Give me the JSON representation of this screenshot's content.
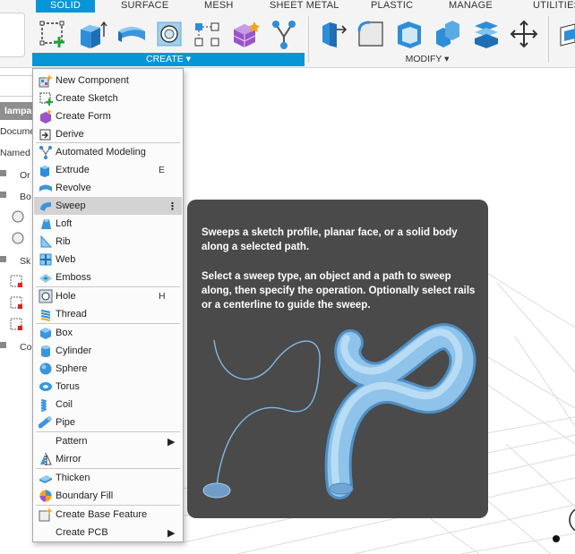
{
  "toolbar": {
    "tabs": [
      "SOLID",
      "SURFACE",
      "MESH",
      "SHEET METAL",
      "PLASTIC",
      "MANAGE",
      "UTILITIES"
    ],
    "create_label": "CREATE ▾",
    "modify_label": "MODIFY ▾",
    "accent": "#0696d7"
  },
  "browser": {
    "rows": [
      "lampa",
      "Docume",
      "Named V",
      "Or",
      "Bo",
      "Sk",
      "Co"
    ]
  },
  "menu": {
    "items": [
      {
        "label": "New Component",
        "icon": "new-component-icon"
      },
      {
        "label": "Create Sketch",
        "icon": "create-sketch-icon"
      },
      {
        "label": "Create Form",
        "icon": "create-form-icon"
      },
      {
        "label": "Derive",
        "icon": "derive-icon"
      },
      {
        "label": "Automated Modeling",
        "icon": "automated-modeling-icon"
      },
      {
        "label": "Extrude",
        "icon": "extrude-icon",
        "shortcut": "E"
      },
      {
        "label": "Revolve",
        "icon": "revolve-icon"
      },
      {
        "label": "Sweep",
        "icon": "sweep-icon"
      },
      {
        "label": "Loft",
        "icon": "loft-icon"
      },
      {
        "label": "Rib",
        "icon": "rib-icon"
      },
      {
        "label": "Web",
        "icon": "web-icon"
      },
      {
        "label": "Emboss",
        "icon": "emboss-icon"
      },
      {
        "label": "Hole",
        "icon": "hole-icon",
        "shortcut": "H"
      },
      {
        "label": "Thread",
        "icon": "thread-icon"
      },
      {
        "label": "Box",
        "icon": "box-icon"
      },
      {
        "label": "Cylinder",
        "icon": "cylinder-icon"
      },
      {
        "label": "Sphere",
        "icon": "sphere-icon"
      },
      {
        "label": "Torus",
        "icon": "torus-icon"
      },
      {
        "label": "Coil",
        "icon": "coil-icon"
      },
      {
        "label": "Pipe",
        "icon": "pipe-icon"
      },
      {
        "label": "Pattern",
        "icon": "pattern-icon"
      },
      {
        "label": "Mirror",
        "icon": "mirror-icon"
      },
      {
        "label": "Thicken",
        "icon": "thicken-icon"
      },
      {
        "label": "Boundary Fill",
        "icon": "boundary-fill-icon"
      },
      {
        "label": "Create Base Feature",
        "icon": "base-feature-icon"
      },
      {
        "label": "Create PCB",
        "icon": "pcb-icon"
      }
    ]
  },
  "tooltip": {
    "title": "Sweeps a sketch profile, planar face, or a solid body along a selected path.",
    "body": "Select a sweep type, an object and a path to sweep along, then specify the operation. Optionally select rails or a centerline to guide the sweep."
  }
}
